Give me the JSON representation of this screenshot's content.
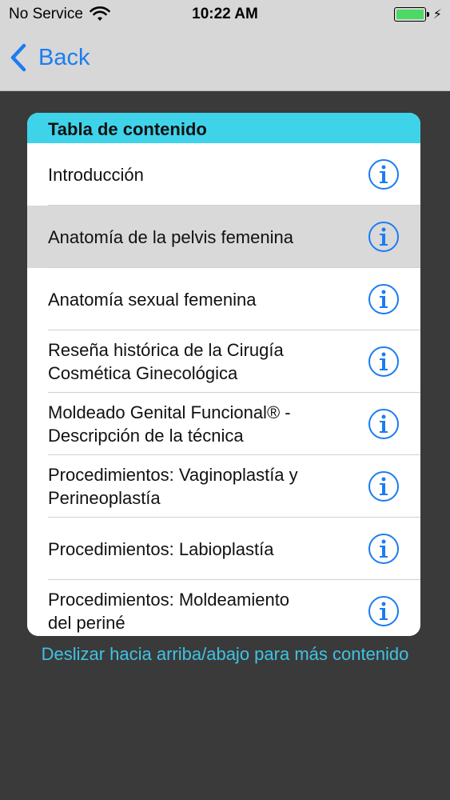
{
  "status_bar": {
    "carrier": "No Service",
    "time": "10:22 AM",
    "wifi_icon": "wifi-icon",
    "battery_icon": "battery-icon",
    "charging_icon": "charging-bolt-icon",
    "battery_level": 1.0
  },
  "nav": {
    "back_label": "Back",
    "back_icon": "chevron-left-icon"
  },
  "toc": {
    "title": "Tabla de contenido",
    "items": [
      {
        "line1": "Introducción",
        "line2": ""
      },
      {
        "line1": "Anatomía de la pelvis femenina",
        "line2": ""
      },
      {
        "line1": "Anatomía sexual femenina",
        "line2": ""
      },
      {
        "line1": "Reseña histórica de la Cirugía",
        "line2": "Cosmética Ginecológica"
      },
      {
        "line1": "Moldeado Genital Funcional® -",
        "line2": "Descripción de la técnica"
      },
      {
        "line1": "Procedimientos: Vaginoplastía y",
        "line2": "Perineoplastía"
      },
      {
        "line1": "Procedimientos: Labioplastía",
        "line2": ""
      },
      {
        "line1": "Procedimientos: Moldeamiento",
        "line2": "del periné"
      }
    ],
    "selected_index": 1,
    "item_icon": "info-circle-icon"
  },
  "footer": {
    "hint": "Deslizar hacia arriba/abajo para más contenido"
  },
  "colors": {
    "accent_blue": "#1b7cf2",
    "header_cyan": "#3fd3ea",
    "hint_cyan": "#3fc3e3",
    "background": "#3a3a3a",
    "bar_gray": "#d7d7d7",
    "selected_row": "#d9d9d9",
    "battery_green": "#4cd964"
  }
}
